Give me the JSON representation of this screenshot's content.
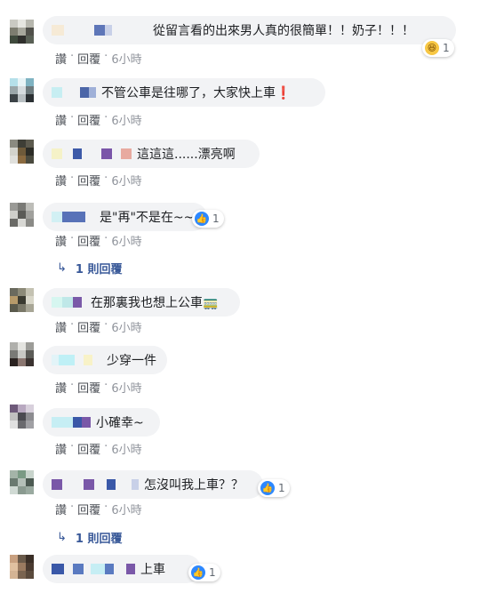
{
  "labels": {
    "like": "讚",
    "reply": "回覆",
    "dot": "·",
    "reply_prefix": "↳"
  },
  "colors": {
    "link": "#385898",
    "muted": "#90949c",
    "bubble": "#f2f3f5",
    "like": "#2d88ff"
  },
  "comments": [
    {
      "text": "從留言看的出來男人真的很簡單！！奶子！！！",
      "time": "6小時",
      "reaction_icon": "haha-icon",
      "reaction_count": "1"
    },
    {
      "text": "不管公車是往哪了，大家快上車❗",
      "time": "6小時"
    },
    {
      "text": "這這這......漂亮啊",
      "time": "6小時"
    },
    {
      "text": "是\"再\"不是在~~~",
      "time": "6小時",
      "reaction_icon": "like-icon",
      "reaction_count": "1",
      "replies": "1 則回覆"
    },
    {
      "text": "在那裏我也想上公車🚃",
      "time": "6小時"
    },
    {
      "text": "少穿一件",
      "time": "6小時"
    },
    {
      "text": "小確幸~",
      "time": "6小時"
    },
    {
      "text": "怎沒叫我上車？？",
      "time": "6小時",
      "reaction_icon": "like-icon",
      "reaction_count": "1",
      "replies": "1 則回覆"
    },
    {
      "text": "上車",
      "time": "",
      "reaction_icon": "like-icon",
      "reaction_count": "1"
    }
  ]
}
